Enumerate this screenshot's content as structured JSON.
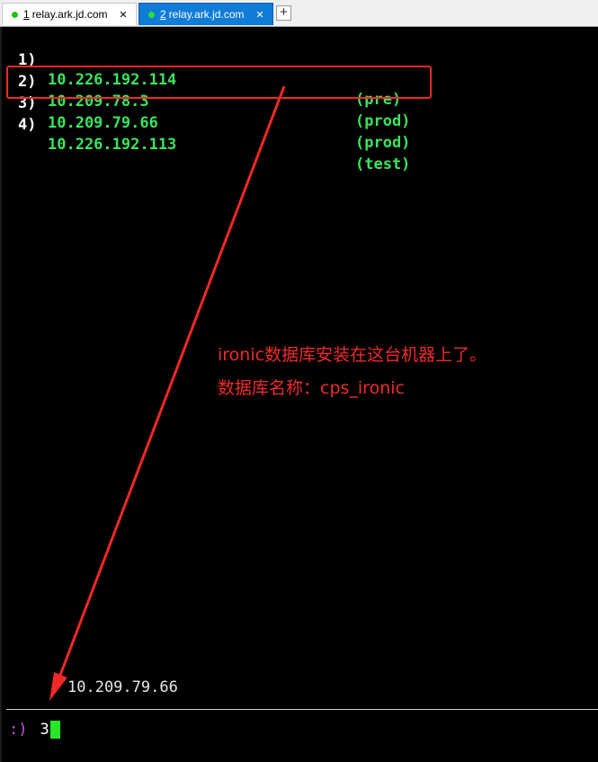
{
  "tabs": [
    {
      "num": "1",
      "label": "relay.ark.jd.com",
      "active": false,
      "close": "✕"
    },
    {
      "num": "2",
      "label": "relay.ark.jd.com",
      "active": true,
      "close": "✕"
    }
  ],
  "add_tab_label": "+",
  "hosts": [
    {
      "index": "1)",
      "ip": "10.226.192.114",
      "env": "(pre)"
    },
    {
      "index": "2)",
      "ip": "10.209.78.3",
      "env": "(prod)"
    },
    {
      "index": "3)",
      "ip": "10.209.79.66",
      "env": "(prod)"
    },
    {
      "index": "4)",
      "ip": "10.226.192.113",
      "env": "(test)"
    }
  ],
  "annotation": {
    "line1": "ironic数据库安装在这台机器上了。",
    "line2": "数据库名称：cps_ironic",
    "color": "#f02a2a"
  },
  "selected_ip": "10.209.79.66",
  "prompt": {
    "symbol": ":)",
    "input": "3"
  },
  "colors": {
    "ip_green": "#3ce35f",
    "tab_active": "#0f7cd7",
    "status_dot": "#1ec21e",
    "cursor": "#26e626"
  }
}
